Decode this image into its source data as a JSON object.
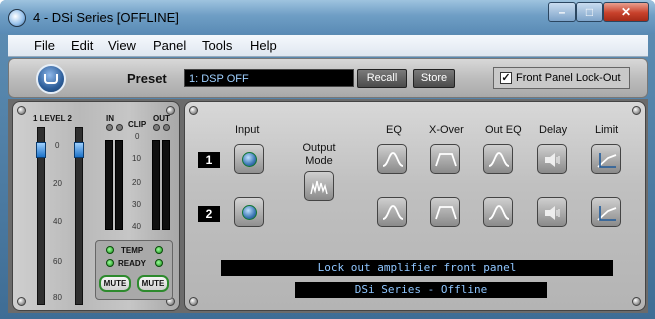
{
  "window": {
    "title": "4 - DSi Series [OFFLINE]"
  },
  "menu": [
    "File",
    "Edit",
    "View",
    "Panel",
    "Tools",
    "Help"
  ],
  "preset": {
    "label": "Preset",
    "value": "1: DSP OFF",
    "recall_label": "Recall",
    "store_label": "Store",
    "lockout_label": "Front Panel Lock-Out",
    "lockout_checked": true
  },
  "left_panel": {
    "level_label": "1 LEVEL 2",
    "in_label": "IN",
    "clip_label": "CLIP",
    "out_label": "OUT",
    "fader_scale": [
      "0",
      "20",
      "40",
      "60",
      "80"
    ],
    "meter_scale": [
      "0",
      "10",
      "20",
      "30",
      "40"
    ],
    "temp_label": "TEMP",
    "ready_label": "READY",
    "mute1_label": "MUTE",
    "mute2_label": "MUTE"
  },
  "right_panel": {
    "headers": {
      "input": "Input",
      "output_mode": "Output Mode",
      "eq": "EQ",
      "xover": "X-Over",
      "out_eq": "Out EQ",
      "delay": "Delay",
      "limit": "Limit"
    },
    "channels": [
      "1",
      "2"
    ],
    "message": "Lock out amplifier front panel",
    "status": "DSi Series - Offline"
  }
}
